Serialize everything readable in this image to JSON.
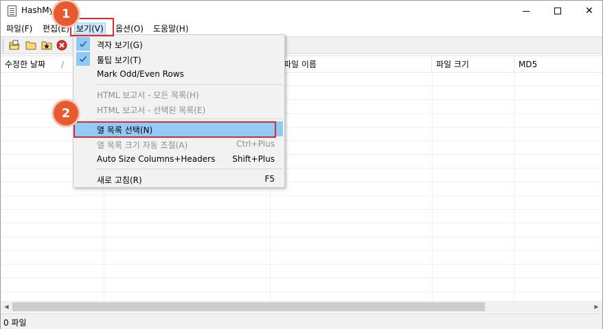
{
  "window": {
    "title": "HashMyF",
    "minimize_glyph": "",
    "maximize_glyph": "",
    "close_glyph": "✕"
  },
  "menubar": {
    "items": [
      {
        "label": "파일(F)"
      },
      {
        "label": "편집(E)"
      },
      {
        "label": "보기(V)"
      },
      {
        "label": "옵션(O)"
      },
      {
        "label": "도움말(H)"
      }
    ]
  },
  "toolbar": {
    "icons": [
      "open-file-icon",
      "folder-icon",
      "star-folder-icon",
      "stop-icon"
    ]
  },
  "list": {
    "columns": [
      {
        "label": "수정한 날짜"
      },
      {
        "label": ""
      },
      {
        "label": "파일 이름"
      },
      {
        "label": "파일 크기"
      },
      {
        "label": "MD5"
      }
    ],
    "sort_indicator": "/"
  },
  "statusbar": {
    "text": "0 파일"
  },
  "view_menu": {
    "items": [
      {
        "label": "격자 보기(G)",
        "checked": true,
        "enabled": true,
        "shortcut": ""
      },
      {
        "label": "툴팁 보기(T)",
        "checked": true,
        "enabled": true,
        "shortcut": ""
      },
      {
        "label": "Mark Odd/Even Rows",
        "checked": false,
        "enabled": true,
        "shortcut": ""
      },
      {
        "label": "HTML 보고서 - 모든 목록(H)",
        "checked": false,
        "enabled": false,
        "shortcut": ""
      },
      {
        "label": "HTML 보고서 - 선택된 목록(E)",
        "checked": false,
        "enabled": false,
        "shortcut": ""
      },
      {
        "label": "열 목록 선택(N)",
        "checked": false,
        "enabled": true,
        "shortcut": "",
        "highlighted": true
      },
      {
        "label": "열 목록 크기 자동 조절(A)",
        "checked": false,
        "enabled": false,
        "shortcut": "Ctrl+Plus"
      },
      {
        "label": "Auto Size Columns+Headers",
        "checked": false,
        "enabled": true,
        "shortcut": "Shift+Plus"
      },
      {
        "label": "새로 고침(R)",
        "checked": false,
        "enabled": true,
        "shortcut": "F5"
      }
    ]
  },
  "annotations": {
    "step1": "1",
    "step2": "2"
  },
  "colors": {
    "highlight": "#91c9f7",
    "menu_bg": "#f2f2f2",
    "annotation_red": "#e0262d",
    "badge_orange": "#e85a2e"
  }
}
